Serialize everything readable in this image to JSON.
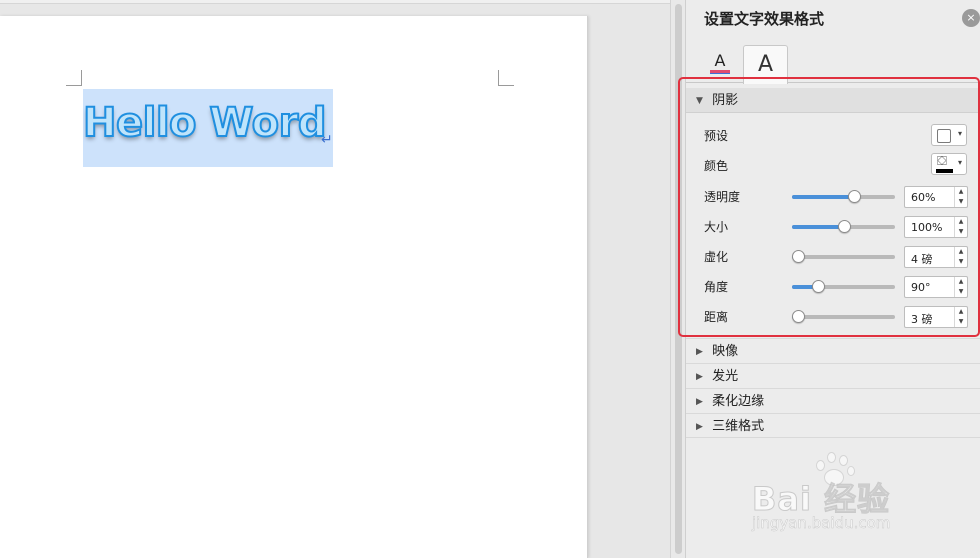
{
  "document": {
    "text": "Hello Word",
    "paragraph_mark": "↵"
  },
  "panel": {
    "title": "设置文字效果格式",
    "close_icon": "×",
    "tabs": [
      {
        "icon": "text-fill-outline-icon",
        "glyph": "A"
      },
      {
        "icon": "text-effects-icon",
        "glyph": "A"
      }
    ]
  },
  "shadow": {
    "header": "阴影",
    "preset_label": "预设",
    "color_label": "颜色",
    "color_value": "#000000",
    "rows": [
      {
        "label": "透明度",
        "value": "60%",
        "fraction": 0.6
      },
      {
        "label": "大小",
        "value": "100%",
        "fraction": 0.5
      },
      {
        "label": "虚化",
        "value": "4 磅",
        "fraction": 0.06
      },
      {
        "label": "角度",
        "value": "90°",
        "fraction": 0.25
      },
      {
        "label": "距离",
        "value": "3 磅",
        "fraction": 0.04
      }
    ]
  },
  "sections": [
    {
      "label": "映像"
    },
    {
      "label": "发光"
    },
    {
      "label": "柔化边缘"
    },
    {
      "label": "三维格式"
    }
  ],
  "icons": {
    "expanded": "▼",
    "collapsed": "▶",
    "dropdown": "▾",
    "spin_up": "▲",
    "spin_down": "▼",
    "fill_bucket": "⛋"
  },
  "watermark": {
    "text": "Bai 经验",
    "url": "jingyan.baidu.com"
  },
  "colors": {
    "accent": "#4a90d9",
    "highlight_border": "#e0313f",
    "text_outline": "#1f8fe0",
    "selection": "#cde2fb"
  }
}
